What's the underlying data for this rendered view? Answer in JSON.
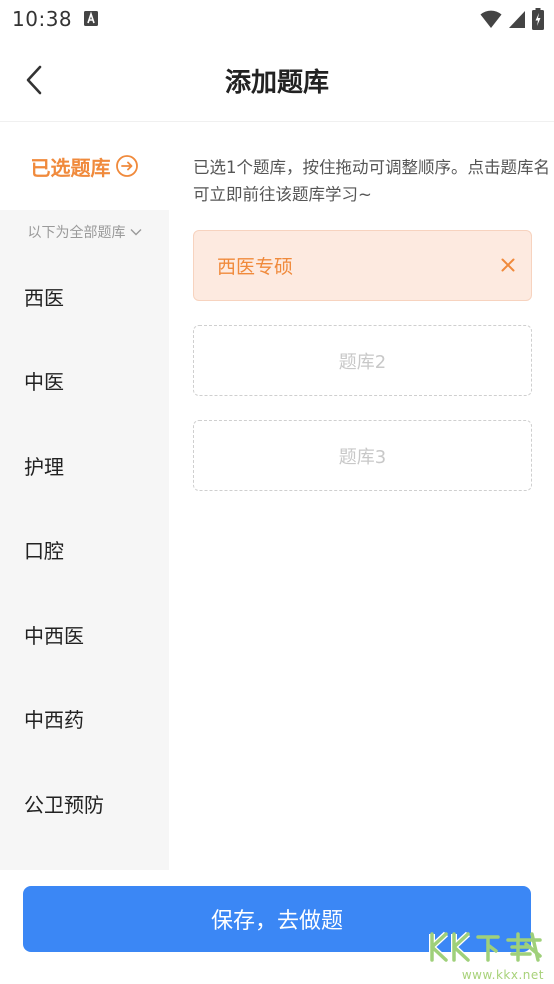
{
  "status_bar": {
    "time": "10:38"
  },
  "header": {
    "title": "添加题库",
    "back_icon": "chevron-left-icon"
  },
  "sidebar": {
    "selected_label": "已选题库",
    "all_hint": "以下为全部题库",
    "categories": [
      "西医",
      "中医",
      "护理",
      "口腔",
      "中西医",
      "中西药",
      "公卫预防"
    ]
  },
  "main": {
    "instructions": "已选1个题库，按住拖动可调整顺序。点击题库名可立即前往该题库学习~",
    "selected_bank": "西医专硕",
    "empty_slots": [
      "题库2",
      "题库3"
    ]
  },
  "footer": {
    "save_label": "保存，去做题"
  },
  "watermark": {
    "url": "www.kkx.net"
  },
  "colors": {
    "accent_orange": "#f08a3c",
    "primary_blue": "#3b87f5",
    "sidebar_bg": "#f6f6f6",
    "filled_slot_bg": "#fdeae0"
  }
}
